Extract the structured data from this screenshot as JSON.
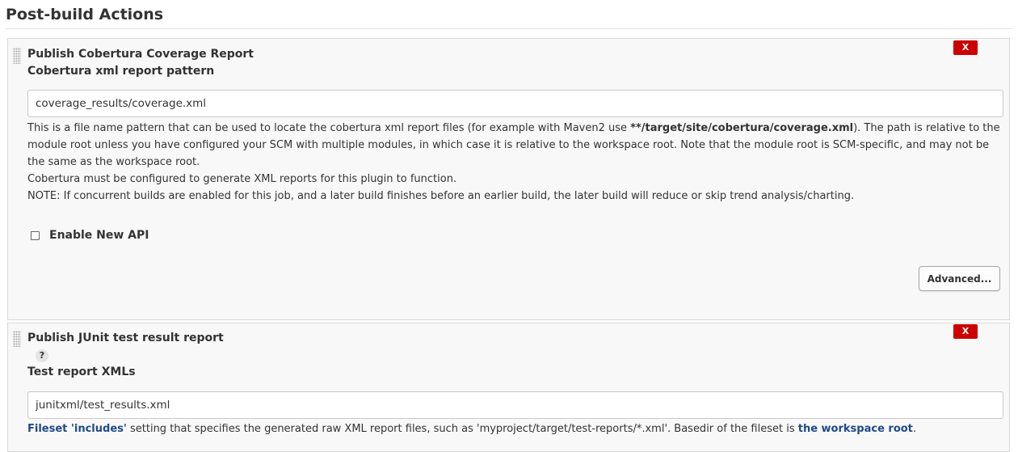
{
  "section": {
    "title": "Post-build Actions"
  },
  "cobertura": {
    "title": "Publish Cobertura Coverage Report",
    "delete_label": "X",
    "field_label": "Cobertura xml report pattern",
    "pattern_value": "coverage_results/coverage.xml",
    "help_p1_before": "This is a file name pattern that can be used to locate the cobertura xml report files (for example with Maven2 use ",
    "help_p1_bold": "**/target/site/cobertura/coverage.xml",
    "help_p1_after": "). The path is relative to the module root unless you have configured your SCM with multiple modules, in which case it is relative to the workspace root. Note that the module root is SCM-specific, and may not be the same as the workspace root.",
    "help_p2": "Cobertura must be configured to generate XML reports for this plugin to function.",
    "help_p3": "NOTE: If concurrent builds are enabled for this job, and a later build finishes before an earlier build, the later build will reduce or skip trend analysis/charting.",
    "enable_new_api_label": "Enable New API",
    "enable_new_api_checked": false,
    "advanced_label": "Advanced..."
  },
  "junit": {
    "title": "Publish JUnit test result report",
    "delete_label": "X",
    "help_icon": "?",
    "field_label": "Test report XMLs",
    "xml_value": "junitxml/test_results.xml",
    "help_link1": "Fileset 'includes'",
    "help_middle": " setting that specifies the generated raw XML report files, such as 'myproject/target/test-reports/*.xml'. Basedir of the fileset is ",
    "help_link2": "the workspace root",
    "help_end": "."
  },
  "colors": {
    "delete_button": "#cc0000",
    "link": "#204a87",
    "panel_bg": "#f8f8f8"
  },
  "icons": {
    "drag_handle": "drag-handle-icon",
    "help": "help-icon"
  }
}
